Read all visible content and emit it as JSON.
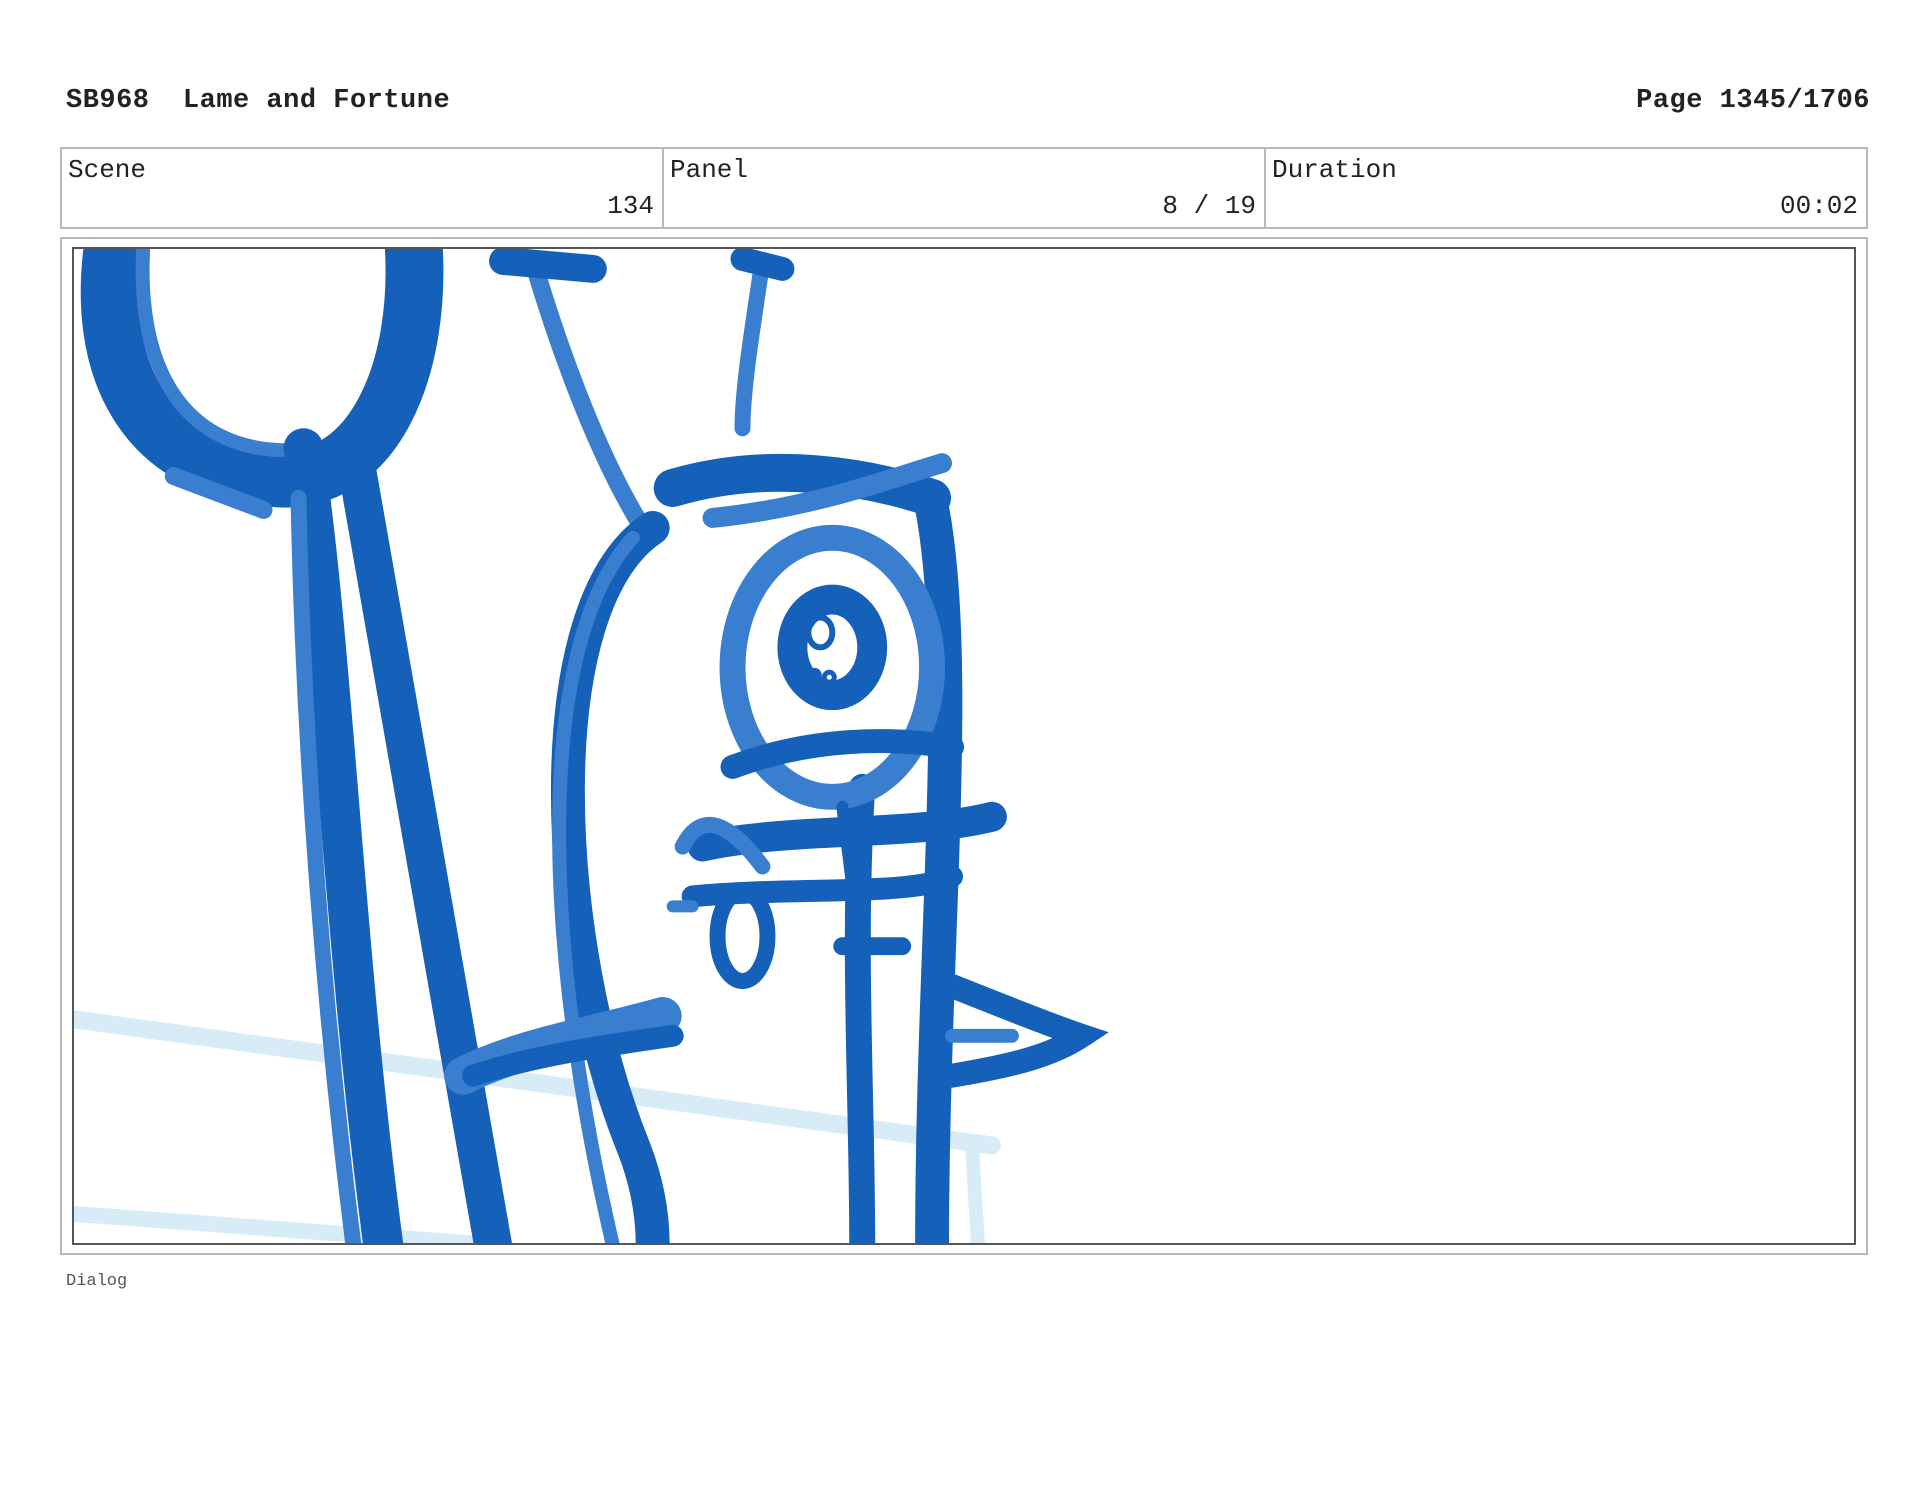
{
  "header": {
    "production": "SB968  Lame and Fortune",
    "page": "Page 1345/1706"
  },
  "info": {
    "scene_label": "Scene",
    "scene_value": "134",
    "panel_label": "Panel",
    "panel_value": "8 / 19",
    "duration_label": "Duration",
    "duration_value": "00:02"
  },
  "panel": {
    "description": "",
    "sketch_color": "#1560b8",
    "sketch_light_color": "#3a7fcf",
    "background_line_color": "#d8ecf8"
  },
  "footer": {
    "dialog_label": "Dialog"
  }
}
